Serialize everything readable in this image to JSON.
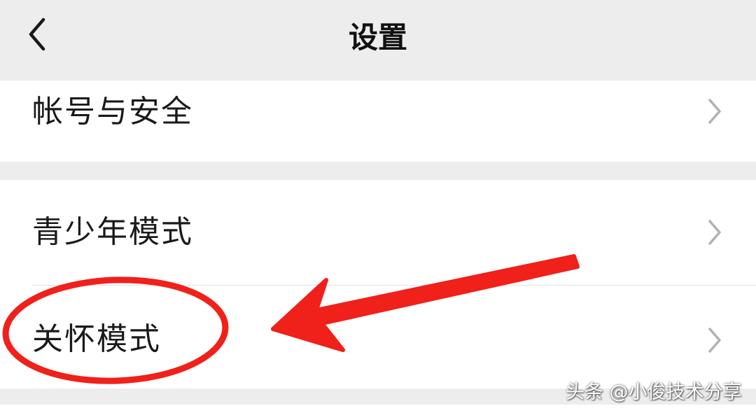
{
  "header": {
    "title": "设置",
    "back_icon": "chevron-left-icon"
  },
  "settings": {
    "items": [
      {
        "label": "帐号与安全",
        "icon": "chevron-right-icon"
      },
      {
        "label": "青少年模式",
        "icon": "chevron-right-icon"
      },
      {
        "label": "关怀模式",
        "icon": "chevron-right-icon"
      }
    ]
  },
  "annotation": {
    "color": "#f0201a",
    "shapes": [
      "ellipse",
      "arrow"
    ]
  },
  "watermark": "头条 @小俊技术分享",
  "colors": {
    "background": "#ededed",
    "card": "#ffffff",
    "text": "#111111",
    "chevron": "#b2b2b2"
  }
}
